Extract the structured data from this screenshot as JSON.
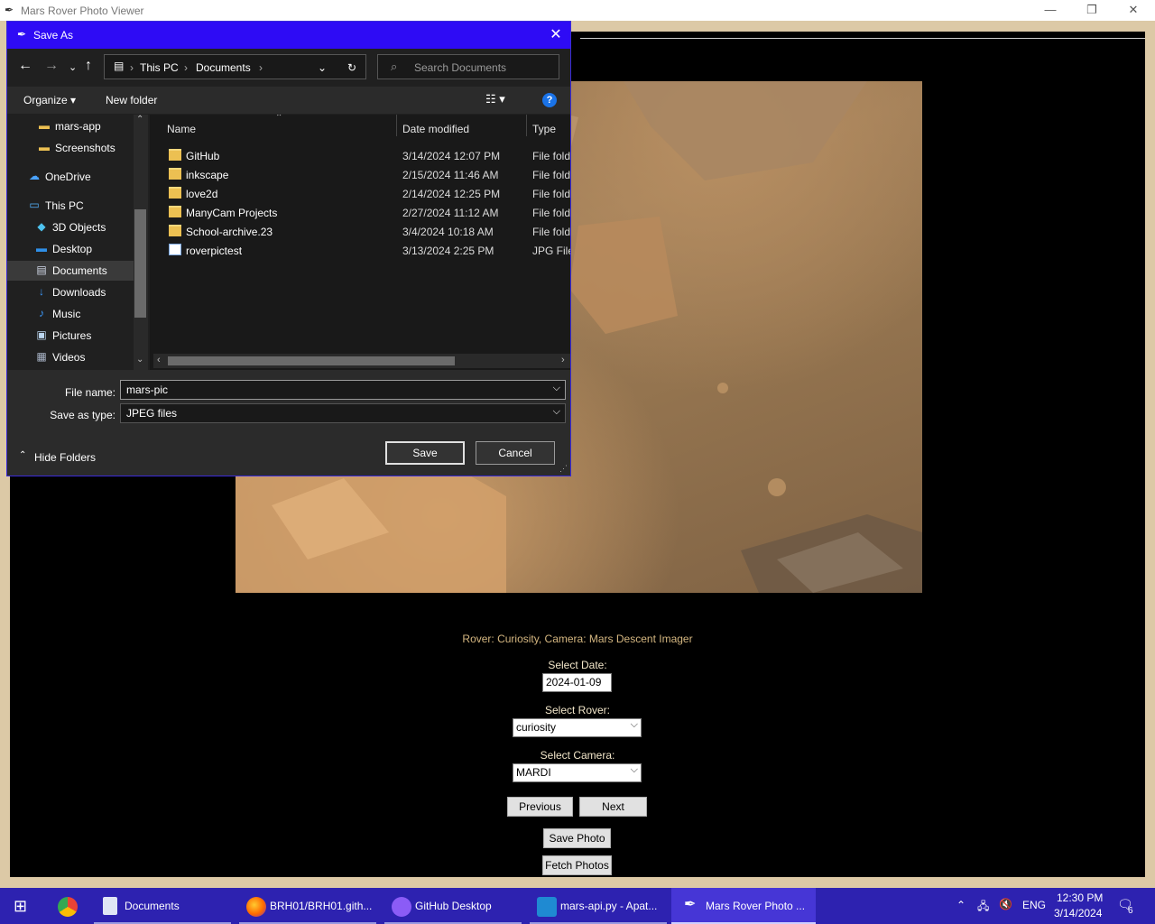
{
  "app": {
    "title": "Mars Rover Photo Viewer",
    "rover_info": "Rover: Curiosity, Camera: Mars Descent Imager",
    "date_label": "Select Date:",
    "date_value": "2024-01-09",
    "rover_label": "Select Rover:",
    "rover_value": "curiosity",
    "camera_label": "Select Camera:",
    "camera_value": "MARDI",
    "previous_label": "Previous",
    "next_label": "Next",
    "save_photo_label": "Save Photo",
    "fetch_photos_label": "Fetch Photos"
  },
  "dialog": {
    "title": "Save As",
    "breadcrumb": [
      "This PC",
      "Documents"
    ],
    "search_placeholder": "Search Documents",
    "toolbar": {
      "organize": "Organize",
      "new_folder": "New folder"
    },
    "nav_items": [
      {
        "label": "mars-app",
        "icon": "folder-icon"
      },
      {
        "label": "Screenshots",
        "icon": "folder-icon"
      },
      {
        "label": "OneDrive",
        "icon": "cloud-icon"
      },
      {
        "label": "This PC",
        "icon": "computer-icon"
      },
      {
        "label": "3D Objects",
        "icon": "cube-icon"
      },
      {
        "label": "Desktop",
        "icon": "desktop-icon"
      },
      {
        "label": "Documents",
        "icon": "documents-icon"
      },
      {
        "label": "Downloads",
        "icon": "download-icon"
      },
      {
        "label": "Music",
        "icon": "music-icon"
      },
      {
        "label": "Pictures",
        "icon": "pictures-icon"
      },
      {
        "label": "Videos",
        "icon": "videos-icon"
      }
    ],
    "columns": {
      "name": "Name",
      "date": "Date modified",
      "type": "Type"
    },
    "files": [
      {
        "name": "GitHub",
        "date": "3/14/2024 12:07 PM",
        "type": "File folder",
        "icon": "folder-icon"
      },
      {
        "name": "inkscape",
        "date": "2/15/2024 11:46 AM",
        "type": "File folder",
        "icon": "folder-icon"
      },
      {
        "name": "love2d",
        "date": "2/14/2024 12:25 PM",
        "type": "File folder",
        "icon": "folder-icon"
      },
      {
        "name": "ManyCam Projects",
        "date": "2/27/2024 11:12 AM",
        "type": "File folder",
        "icon": "folder-icon"
      },
      {
        "name": "School-archive.23",
        "date": "3/4/2024 10:18 AM",
        "type": "File folder",
        "icon": "folder-icon"
      },
      {
        "name": "roverpictest",
        "date": "3/13/2024 2:25 PM",
        "type": "JPG File",
        "icon": "jpg-file-icon"
      }
    ],
    "file_name_label": "File name:",
    "file_name_value": "mars-pic",
    "save_type_label": "Save as type:",
    "save_type_value": "JPEG files",
    "save_button": "Save",
    "cancel_button": "Cancel",
    "hide_folders": "Hide Folders"
  },
  "taskbar": {
    "apps": [
      {
        "label": "",
        "icon": "chrome-icon"
      },
      {
        "label": "Documents",
        "icon": "file-explorer-icon"
      },
      {
        "label": "BRH01/BRH01.gith...",
        "icon": "firefox-icon"
      },
      {
        "label": "GitHub Desktop",
        "icon": "github-desktop-icon"
      },
      {
        "label": "mars-api.py - Apat...",
        "icon": "vscode-icon"
      },
      {
        "label": "Mars Rover Photo ...",
        "icon": "feather-icon"
      }
    ],
    "language": "ENG",
    "time": "12:30 PM",
    "date": "3/14/2024",
    "notification_count": "6"
  },
  "colors": {
    "dialog_title_bar": "#2e0bf5",
    "taskbar": "#2d22b0",
    "app_background": "#000000",
    "info_text": "#d4b680"
  }
}
